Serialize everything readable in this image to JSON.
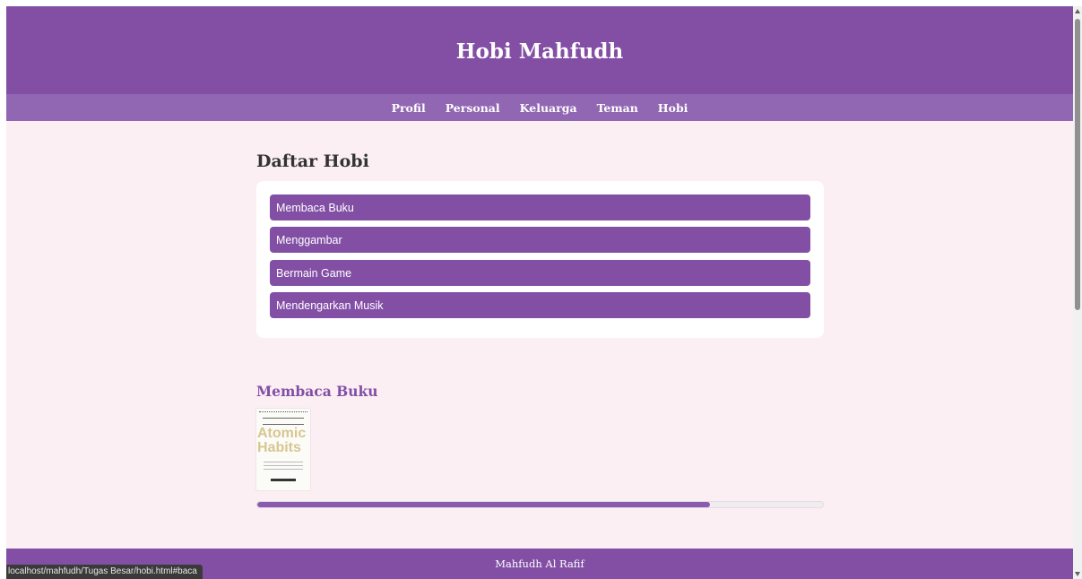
{
  "header": {
    "title": "Hobi Mahfudh"
  },
  "nav": {
    "items": [
      "Profil",
      "Personal",
      "Keluarga",
      "Teman",
      "Hobi"
    ]
  },
  "main": {
    "section_title": "Daftar Hobi",
    "hobbies": [
      "Membaca Buku",
      "Menggambar",
      "Bermain Game",
      "Mendengarkan Musik"
    ],
    "detail_title": "Membaca Buku",
    "book": {
      "title_lines": [
        "Atomic",
        "Habits"
      ],
      "title_color": "#d9c68f"
    },
    "progress": {
      "fraction": 0.8
    }
  },
  "footer": {
    "text": "Mahfudh Al Rafif"
  },
  "status_bar": {
    "url": "localhost/mahfudh/Tugas Besar/hobi.html#baca"
  },
  "colors": {
    "primary": "#824fa5",
    "nav": "#9166b3",
    "background": "#fbeff4"
  }
}
